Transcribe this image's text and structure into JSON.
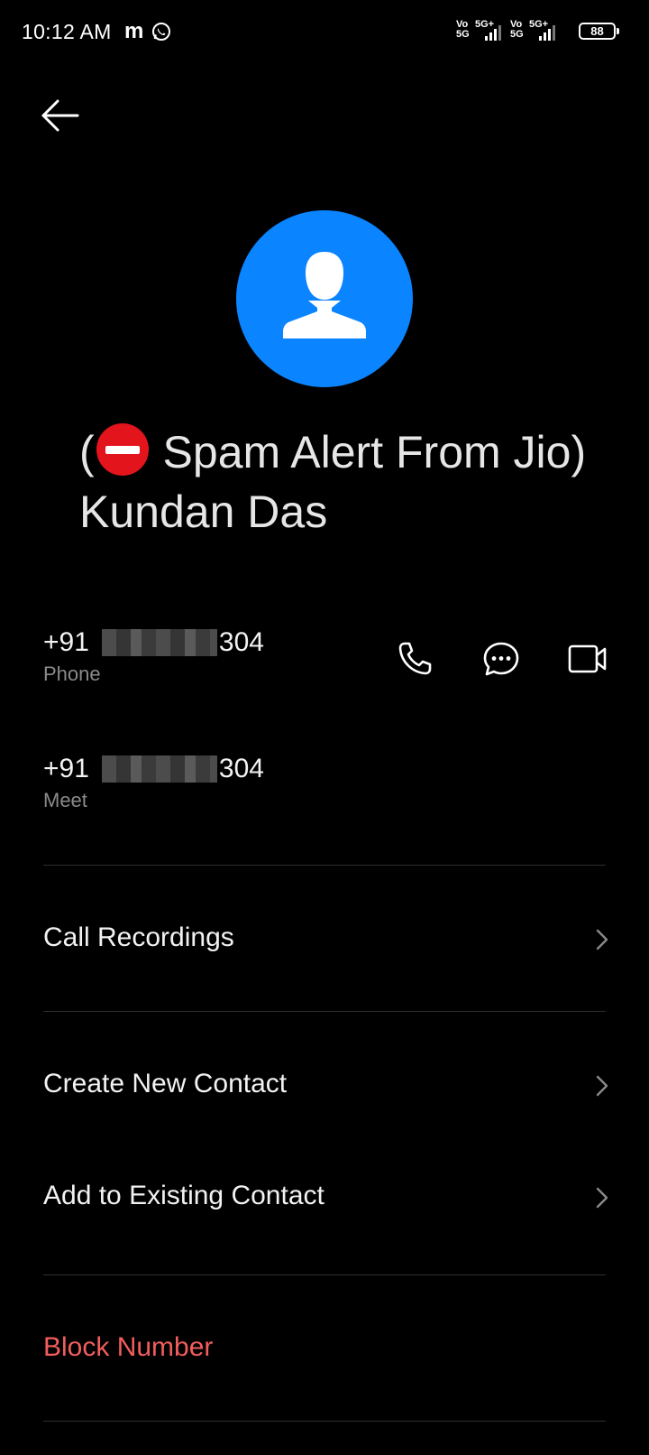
{
  "status_bar": {
    "time": "10:12 AM",
    "sim1_top": "Vo",
    "sim1_bottom": "5G",
    "sim1_net": "5G+",
    "sim2_top": "Vo",
    "sim2_bottom": "5G",
    "sim2_net": "5G+",
    "battery": "88",
    "app_icons": [
      "m-icon",
      "whatsapp-icon"
    ]
  },
  "header": {
    "back_icon": "back-arrow-icon"
  },
  "contact": {
    "name_prefix": "(",
    "name_rest_line": " Spam Alert From Jio) Kundan Das",
    "avatar_icon": "person-icon",
    "avatar_color": "#0a84ff",
    "spam_icon": "no-entry-icon"
  },
  "numbers": [
    {
      "prefix": "+91",
      "suffix": "304",
      "label": "Phone"
    },
    {
      "prefix": "+91",
      "suffix": "304",
      "label": "Meet"
    }
  ],
  "actions": {
    "call_icon": "phone-icon",
    "message_icon": "message-icon",
    "video_icon": "video-call-icon"
  },
  "menu": {
    "call_recordings": "Call Recordings",
    "create_new_contact": "Create New Contact",
    "add_to_existing_contact": "Add to Existing Contact",
    "block_number": "Block Number"
  },
  "colors": {
    "background": "#000000",
    "block_text": "#f25d5d",
    "secondary_text": "#8a8a8a"
  }
}
